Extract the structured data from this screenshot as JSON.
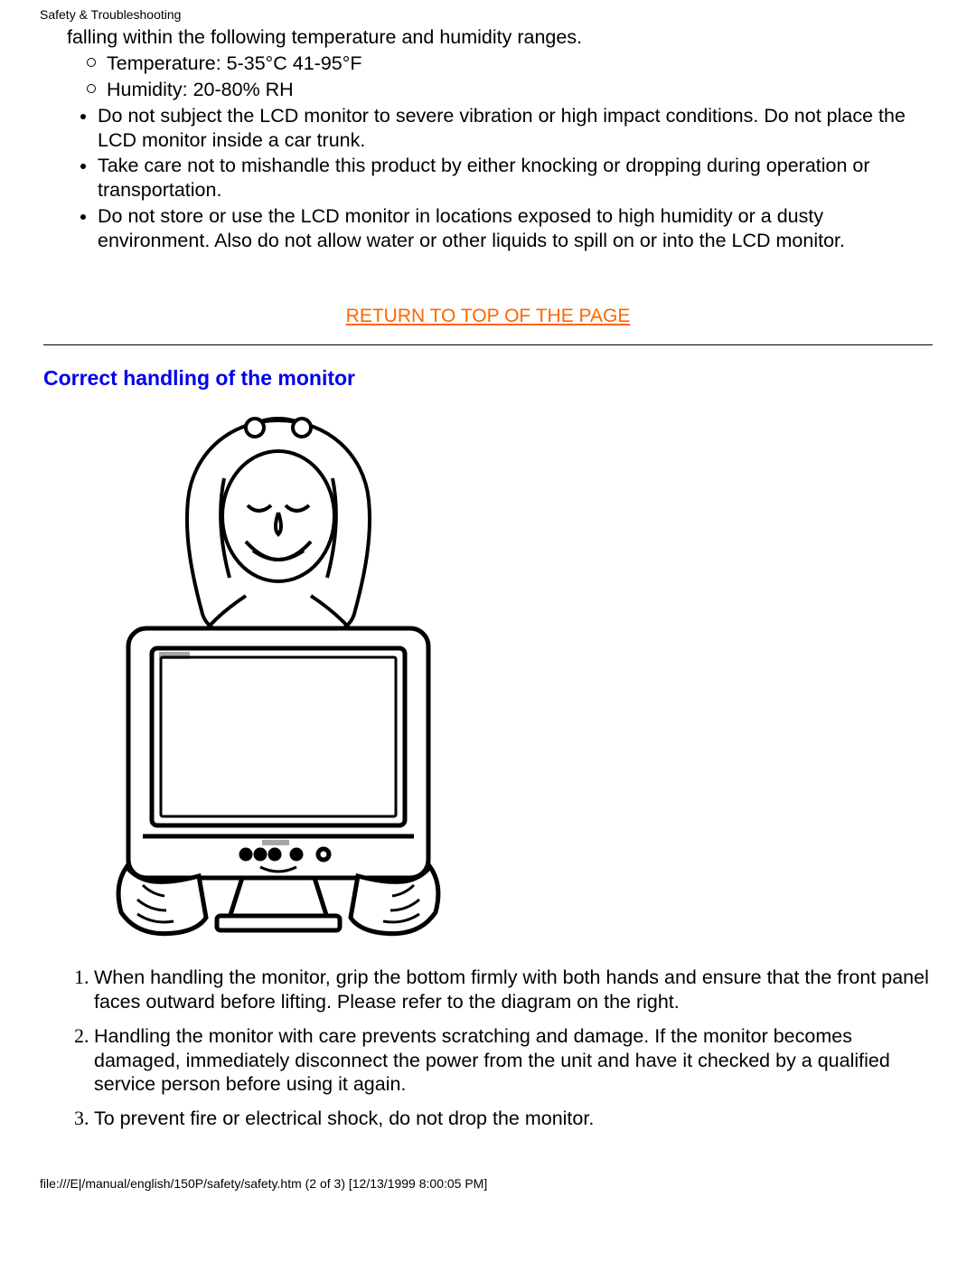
{
  "header": {
    "title": "Safety & Troubleshooting"
  },
  "top": {
    "lead": "falling within the following temperature and humidity ranges.",
    "circle_items": [
      "Temperature: 5-35°C 41-95°F",
      "Humidity: 20-80% RH"
    ],
    "disc_items": [
      "Do not subject the LCD monitor to severe vibration or high impact conditions. Do not place the LCD monitor inside a car trunk.",
      "Take care not to mishandle this product by either knocking or dropping during operation or transportation.",
      "Do not store or use the LCD monitor in locations exposed to high humidity or a dusty environment. Also do not allow water or other liquids to spill on or into the LCD monitor."
    ]
  },
  "return_link": "RETURN TO TOP OF THE PAGE",
  "section": {
    "heading": "Correct handling of the monitor",
    "steps": [
      "When handling the monitor, grip the bottom firmly with both hands and ensure that the front panel faces outward before lifting. Please refer to the diagram on the right.",
      "Handling the monitor with care prevents scratching and damage. If the monitor becomes damaged, immediately disconnect the power from the unit and have it checked by a qualified service person before using it again.",
      "To prevent fire or electrical shock, do not drop the monitor."
    ]
  },
  "footer": {
    "text": "file:///E|/manual/english/150P/safety/safety.htm (2 of 3) [12/13/1999 8:00:05 PM]"
  }
}
